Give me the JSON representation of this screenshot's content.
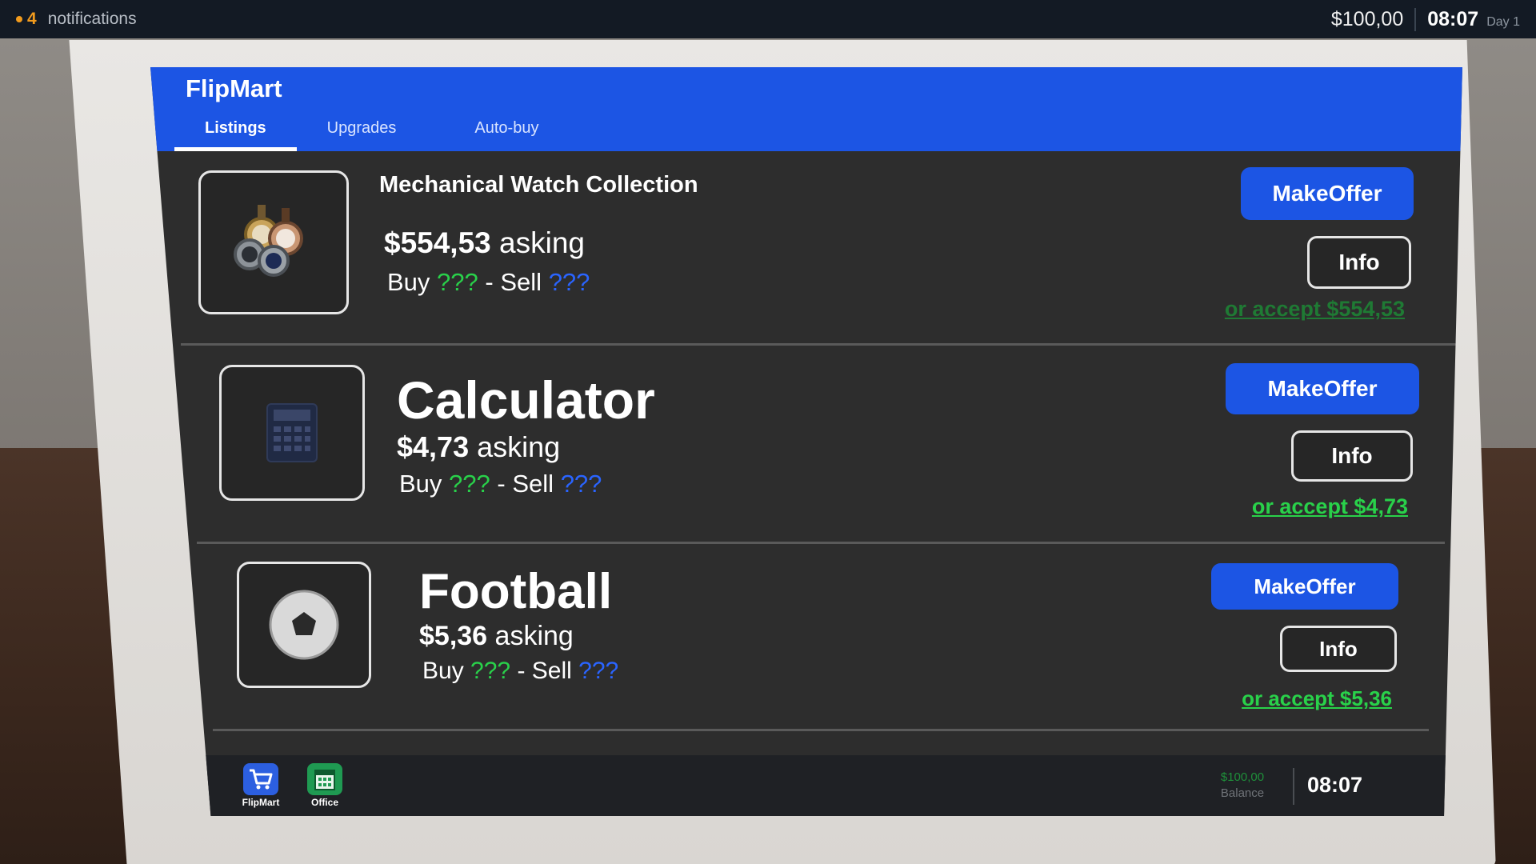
{
  "hud": {
    "notification_count": "4",
    "notification_label": "notifications",
    "money": "$100,00",
    "clock": "08:07",
    "day": "Day 1"
  },
  "app": {
    "title": "FlipMart",
    "tabs": [
      {
        "label": "Listings",
        "active": true
      },
      {
        "label": "Upgrades",
        "active": false
      },
      {
        "label": "Auto-buy",
        "active": false
      }
    ]
  },
  "listings": [
    {
      "name": "Mechanical Watch Collection",
      "price": "$554,53",
      "asking_label": "asking",
      "buy_label": "Buy",
      "buy_value": "???",
      "dash": "-",
      "sell_label": "Sell",
      "sell_value": "???",
      "offer_label": "MakeOffer",
      "info_label": "Info",
      "accept_label": "or accept $554,53",
      "icon": "watch-collection-icon"
    },
    {
      "name": "Calculator",
      "price": "$4,73",
      "asking_label": "asking",
      "buy_label": "Buy",
      "buy_value": "???",
      "dash": "-",
      "sell_label": "Sell",
      "sell_value": "???",
      "offer_label": "MakeOffer",
      "info_label": "Info",
      "accept_label": "or accept $4,73",
      "icon": "calculator-icon"
    },
    {
      "name": "Football",
      "price": "$5,36",
      "asking_label": "asking",
      "buy_label": "Buy",
      "buy_value": "???",
      "dash": "-",
      "sell_label": "Sell",
      "sell_value": "???",
      "offer_label": "MakeOffer",
      "info_label": "Info",
      "accept_label": "or accept $5,36",
      "icon": "football-icon"
    }
  ],
  "taskbar": {
    "apps": [
      {
        "label": "FlipMart",
        "icon": "shopping-cart-icon"
      },
      {
        "label": "Office",
        "icon": "office-building-icon"
      }
    ],
    "balance_value": "$100,00",
    "balance_label": "Balance",
    "clock": "08:07"
  },
  "colors": {
    "brand_blue": "#1c55e4",
    "price_unknown_buy": "#29d14a",
    "price_unknown_sell": "#2a64ff",
    "accept_green": "#29d14a",
    "hud_notification": "#f29b1d"
  }
}
